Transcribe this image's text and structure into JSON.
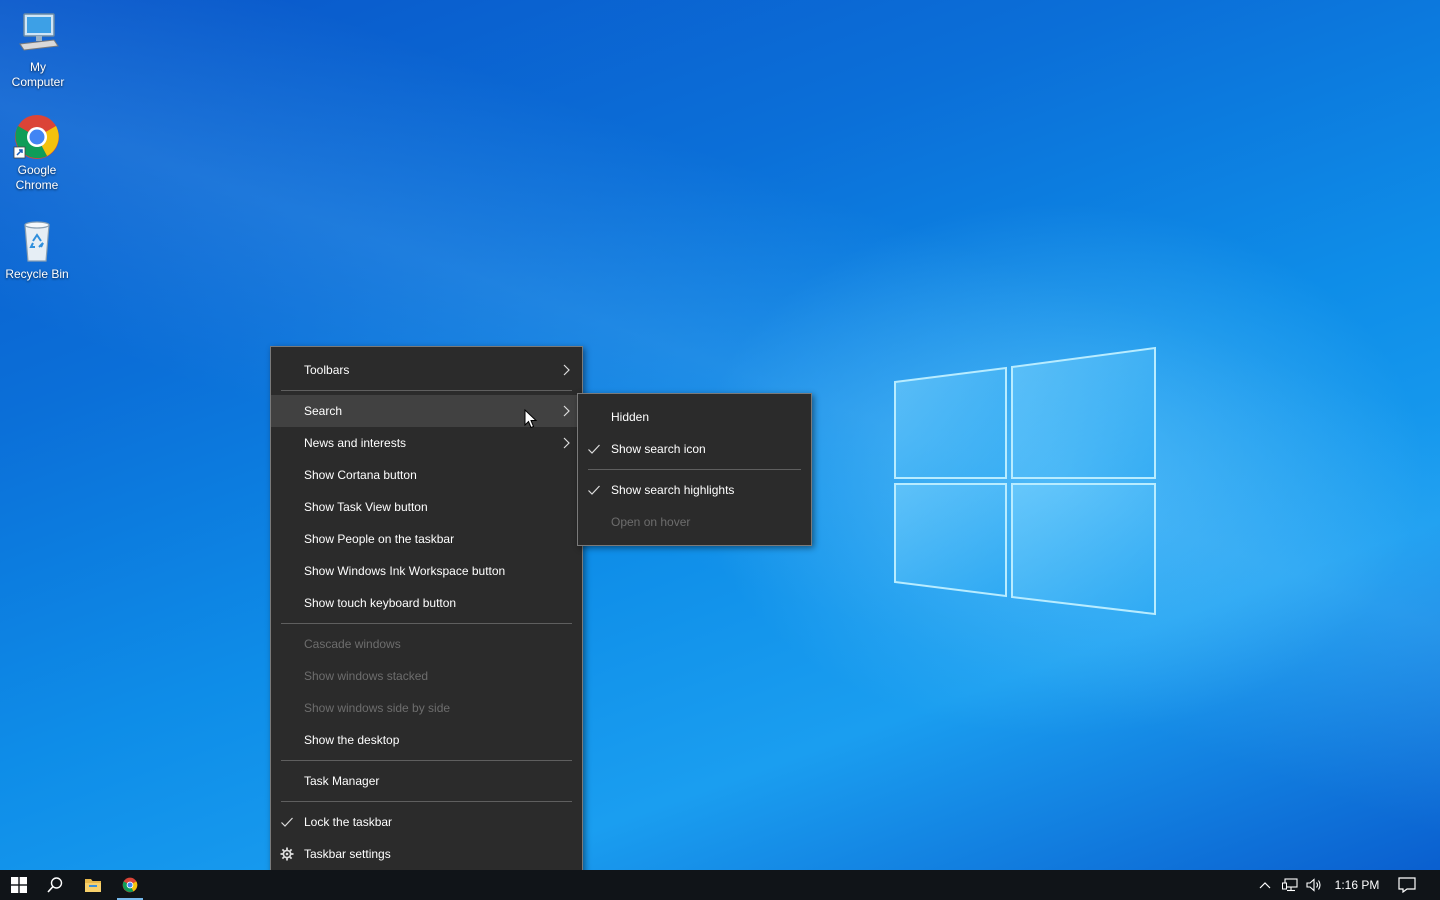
{
  "desktop": {
    "icons": [
      {
        "label": "My\nComputer",
        "icon": "computer-icon"
      },
      {
        "label": "Google\nChrome",
        "icon": "chrome-icon"
      },
      {
        "label": "Recycle Bin",
        "icon": "recycle-bin-icon"
      }
    ]
  },
  "context_menu": {
    "items": [
      {
        "label": "Toolbars",
        "submenu": true
      },
      {
        "label": "Search",
        "submenu": true,
        "hovered": true
      },
      {
        "label": "News and interests",
        "submenu": true
      },
      {
        "label": "Show Cortana button"
      },
      {
        "label": "Show Task View button"
      },
      {
        "label": "Show People on the taskbar"
      },
      {
        "label": "Show Windows Ink Workspace button"
      },
      {
        "label": "Show touch keyboard button"
      },
      {
        "label": "Cascade windows",
        "disabled": true
      },
      {
        "label": "Show windows stacked",
        "disabled": true
      },
      {
        "label": "Show windows side by side",
        "disabled": true
      },
      {
        "label": "Show the desktop"
      },
      {
        "label": "Task Manager"
      },
      {
        "label": "Lock the taskbar",
        "checked": true
      },
      {
        "label": "Taskbar settings",
        "icon": "gear-icon"
      }
    ]
  },
  "search_submenu": {
    "items": [
      {
        "label": "Hidden"
      },
      {
        "label": "Show search icon",
        "checked": true
      },
      {
        "label": "Show search highlights",
        "checked": true
      },
      {
        "label": "Open on hover",
        "disabled": true
      }
    ]
  },
  "taskbar": {
    "clock": "1:16 PM",
    "apps": [
      "start-icon",
      "search-icon",
      "file-explorer-icon",
      "chrome-icon"
    ]
  },
  "colors": {
    "menu_bg": "#2b2b2b",
    "menu_hover": "#414141",
    "taskbar_bg": "#101418",
    "accent": "#76b9ed"
  }
}
